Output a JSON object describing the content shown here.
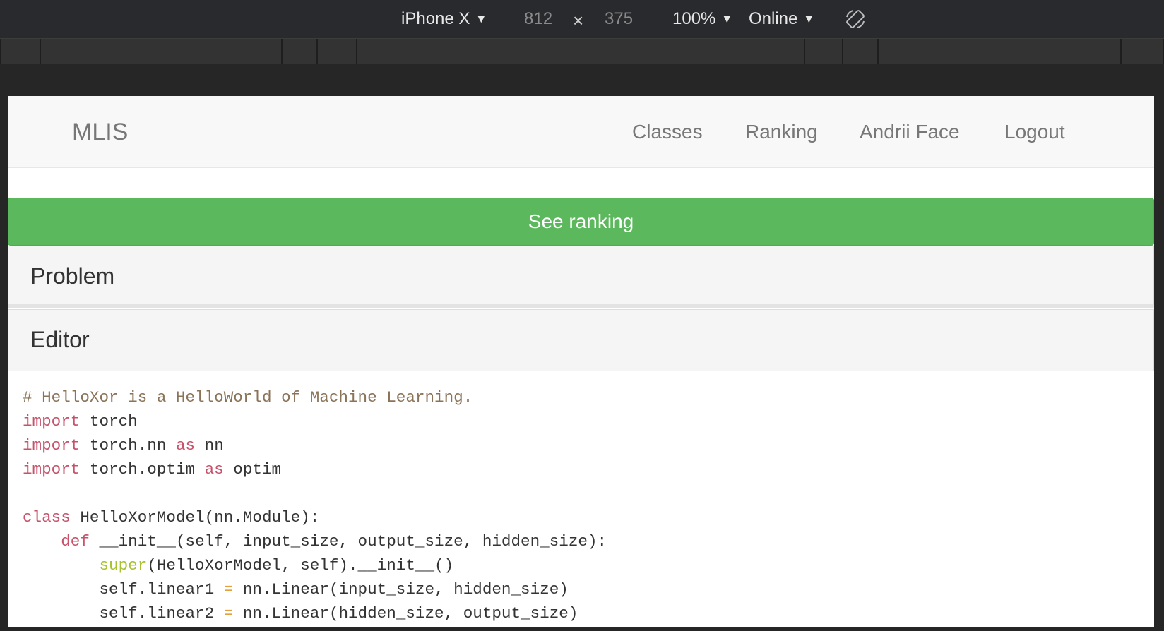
{
  "devtools": {
    "device": "iPhone X",
    "width": "812",
    "times": "×",
    "height": "375",
    "zoom": "100%",
    "network": "Online",
    "caret": "▼",
    "rotate_icon": "rotate-icon"
  },
  "navbar": {
    "brand": "MLIS",
    "links": [
      "Classes",
      "Ranking",
      "Andrii Face",
      "Logout"
    ]
  },
  "see_ranking_button": "See ranking",
  "colors": {
    "success": "#5cb85c",
    "keyword": "#c7526a",
    "comment": "#8b7358",
    "builtin": "#a6c22f"
  },
  "panels": {
    "problem": "Problem",
    "editor": "Editor"
  },
  "code": {
    "line1": "# HelloXor is a HelloWorld of Machine Learning.",
    "kw_import": "import",
    "kw_as": "as",
    "kw_class": "class",
    "kw_def": "def",
    "builtin_super": "super",
    "eq": "=",
    "torch": " torch",
    "torch_nn": " torch.nn ",
    "nn": " nn",
    "torch_optim": " torch.optim ",
    "optim": " optim",
    "class_rest": " HelloXorModel(nn.Module):",
    "def_rest": " __init__(self, input_size, output_size, hidden_size):",
    "super_rest": "(HelloXorModel, self).__init__()",
    "linear1_lhs": "self.linear1 ",
    "linear1_rhs": " nn.Linear(input_size, hidden_size)",
    "linear2_lhs": "self.linear2 ",
    "linear2_rhs": " nn.Linear(hidden_size, output_size)"
  }
}
